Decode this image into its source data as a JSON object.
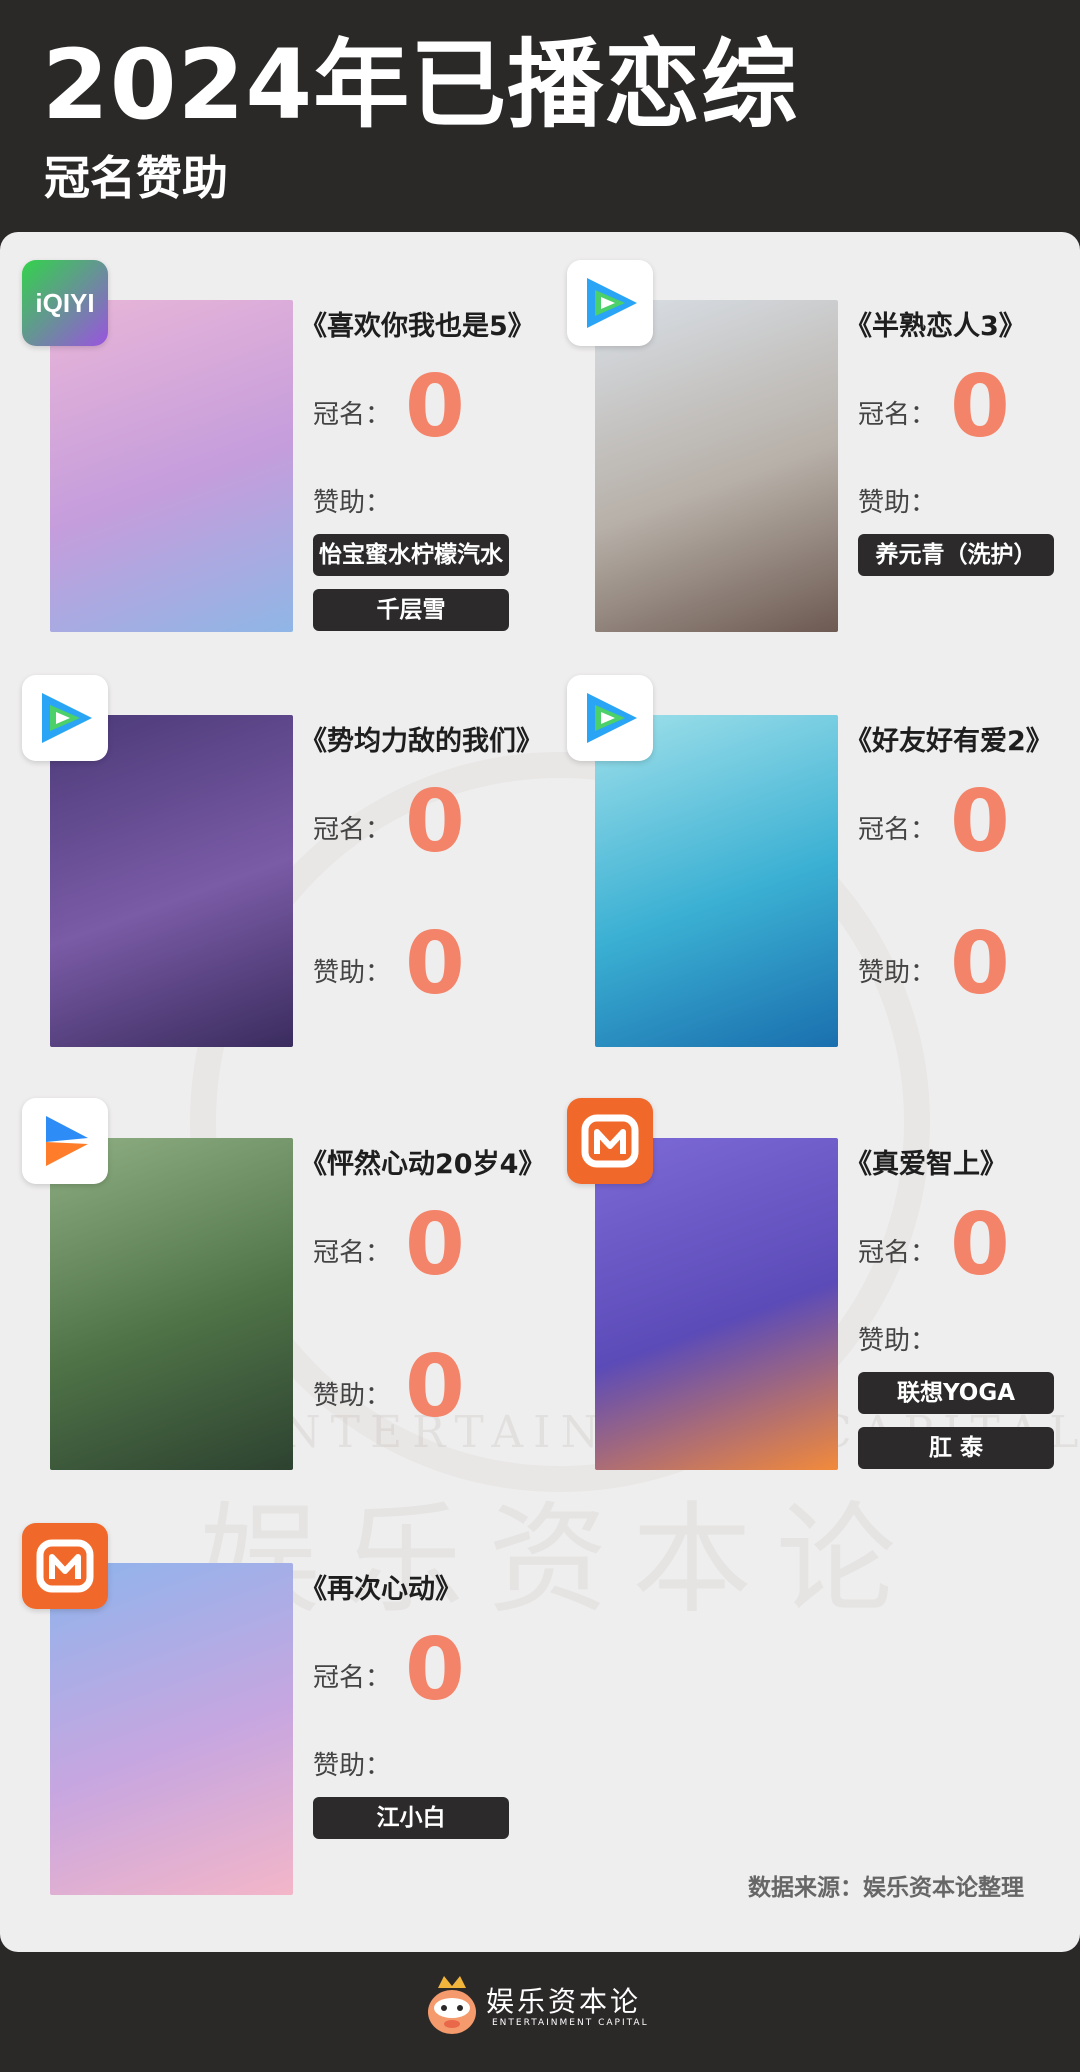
{
  "header": {
    "title": "2024年已播恋综",
    "subtitle": "冠名赞助"
  },
  "watermark": {
    "cn": "娱乐资本论",
    "en": "ENTERTAINMENT CAPITAL"
  },
  "labels": {
    "title_sponsor": "冠名：",
    "sponsor": "赞助："
  },
  "shows": [
    {
      "title": "《喜欢你我也是5》",
      "platform": "iqiyi",
      "platform_text": "iQIYI",
      "title_sponsor_count": "0",
      "sponsors": [
        "怡宝蜜水柠檬汽水",
        "千层雪"
      ],
      "sponsor_count": null,
      "poster_colors": [
        "#e9b6d8",
        "#c59ddc",
        "#8fb6e6"
      ]
    },
    {
      "title": "《半熟恋人3》",
      "platform": "tencent",
      "title_sponsor_count": "0",
      "sponsors": [
        "养元青（洗护）"
      ],
      "sponsor_count": null,
      "poster_colors": [
        "#d9dfe6",
        "#b7b0a8",
        "#6d5a52"
      ]
    },
    {
      "title": "《势均力敌的我们》",
      "platform": "tencent",
      "title_sponsor_count": "0",
      "sponsors": [],
      "sponsor_count": "0",
      "poster_colors": [
        "#4b3a78",
        "#7a5ba6",
        "#3a2c5e"
      ]
    },
    {
      "title": "《好友好有爱2》",
      "platform": "tencent",
      "title_sponsor_count": "0",
      "sponsors": [],
      "sponsor_count": "0",
      "poster_colors": [
        "#9fe0ea",
        "#3bb0d3",
        "#1a6fae"
      ]
    },
    {
      "title": "《怦然心动20岁4》",
      "platform": "youku",
      "title_sponsor_count": "0",
      "sponsors": [],
      "sponsor_count": "0",
      "poster_colors": [
        "#8faf83",
        "#4f7347",
        "#2d4230"
      ]
    },
    {
      "title": "《真爱智上》",
      "platform": "mango",
      "title_sponsor_count": "0",
      "sponsors": [
        "联想YOGA",
        "肛 泰"
      ],
      "sponsor_count": null,
      "poster_colors": [
        "#7d6ad6",
        "#5b4bb8",
        "#f28a3b"
      ]
    },
    {
      "title": "《再次心动》",
      "platform": "mango",
      "title_sponsor_count": "0",
      "sponsors": [
        "江小白"
      ],
      "sponsor_count": null,
      "poster_colors": [
        "#8fb4ec",
        "#c7a6e0",
        "#f3b6c8"
      ]
    }
  ],
  "source_note": "数据来源：娱乐资本论整理",
  "footer": {
    "name": "娱乐资本论",
    "en": "ENTERTAINMENT CAPITAL"
  },
  "colors": {
    "accent_zero": "#f3846a",
    "pill_bg": "#2c2a2a",
    "iqiyi": "#2ccd4b",
    "tencent_blue": "#2aa5f5",
    "tencent_green": "#4bd06a",
    "youku_blue": "#2d8cf5",
    "youku_orange": "#ff7d2a",
    "mango_orange": "#f0692a"
  }
}
